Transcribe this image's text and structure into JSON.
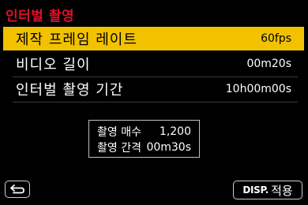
{
  "title": "인터벌 촬영",
  "menu": [
    {
      "label": "제작 프레임 레이트",
      "value": "60fps"
    },
    {
      "label": "비디오 길이",
      "value": "00m20s"
    },
    {
      "label": "인터벌 촬영 기간",
      "value": "10h00m00s"
    }
  ],
  "info": {
    "shots_label": "촬영 매수",
    "shots_value": "1,200",
    "interval_label": "촬영 간격",
    "interval_value": "00m30s"
  },
  "footer": {
    "back_icon": "return-arrow-icon",
    "disp_label": "DISP.",
    "apply_label": "적용"
  },
  "colors": {
    "title": "#e0102a",
    "selected_bg": "#f2c200"
  }
}
